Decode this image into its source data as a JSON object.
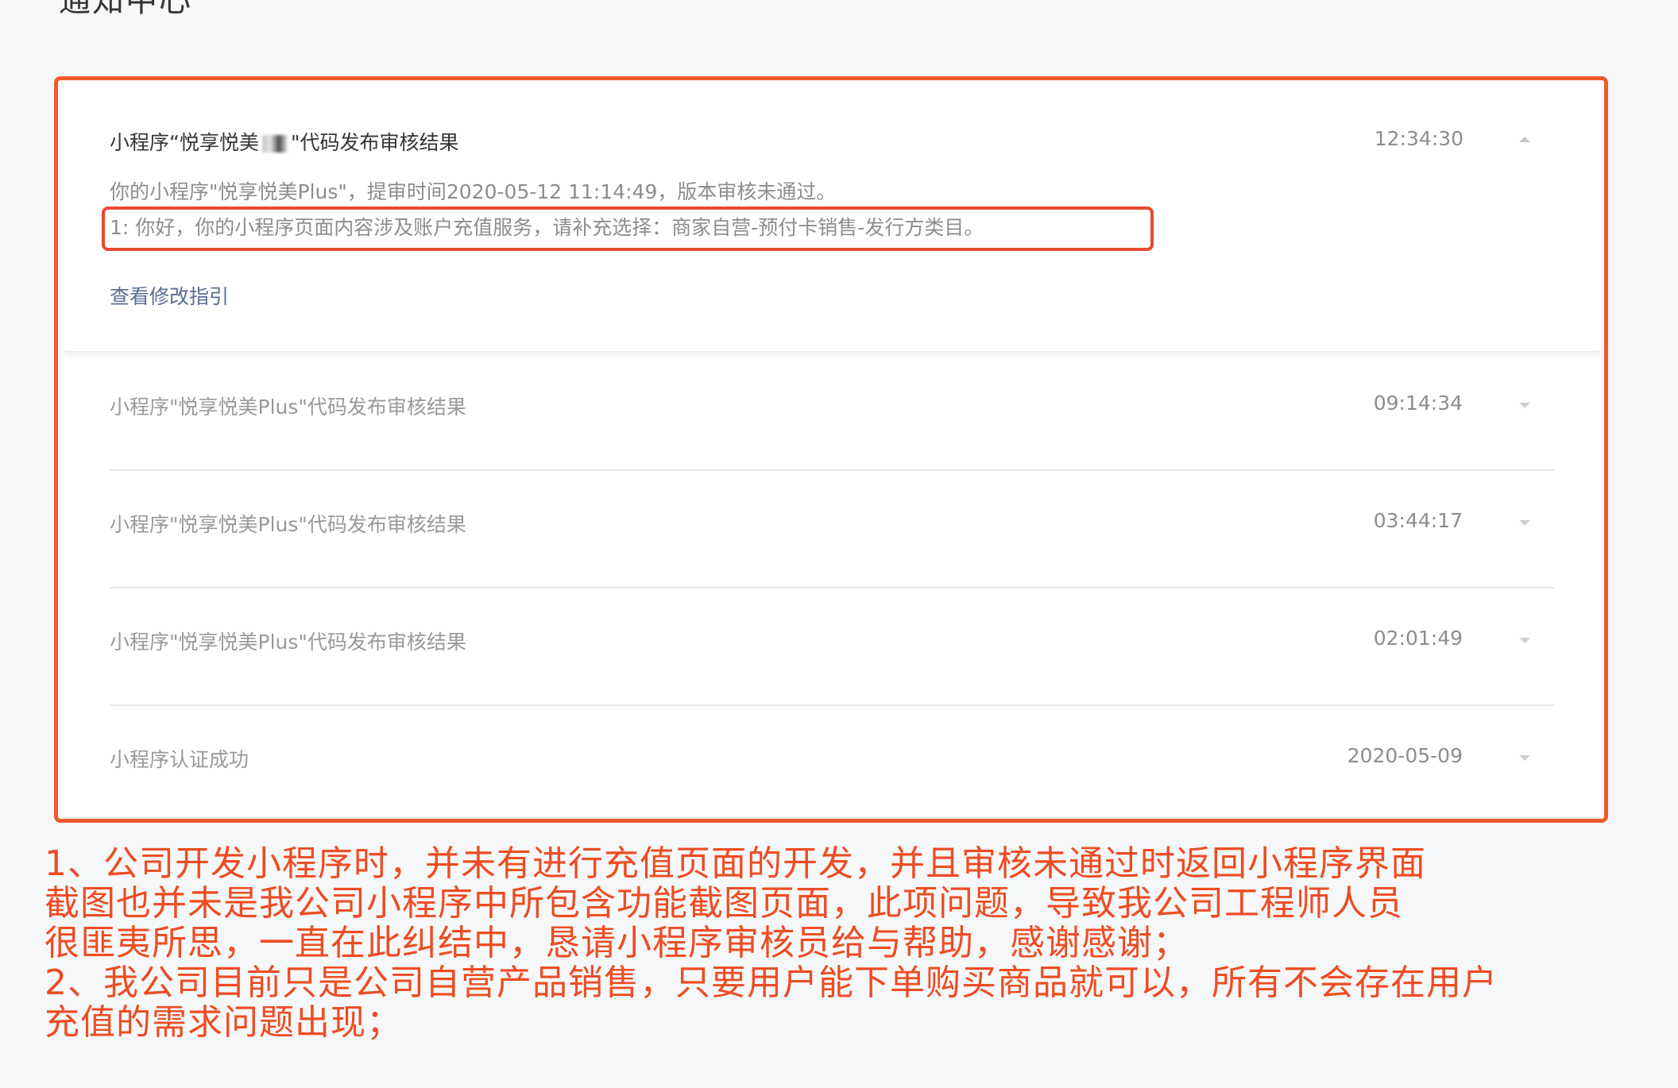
{
  "page": {
    "title": "通知中心"
  },
  "expanded_item": {
    "title_prefix": "小程序“悦享悦美",
    "title_suffix": "\"代码发布审核结果",
    "time": "12:34:30",
    "detail_line1": "你的小程序\"悦享悦美Plus\"，提审时间2020-05-12 11:14:49，版本审核未通过。",
    "detail_line2": "1: 你好，你的小程序页面内容涉及账户充值服务，请补充选择：商家自营-预付卡销售-发行方类目。",
    "guide_link": "查看修改指引",
    "toggle_icon": "caret-up-icon"
  },
  "items": [
    {
      "title": "小程序\"悦享悦美Plus\"代码发布审核结果",
      "time": "09:14:34"
    },
    {
      "title": "小程序\"悦享悦美Plus\"代码发布审核结果",
      "time": "03:44:17"
    },
    {
      "title": "小程序\"悦享悦美Plus\"代码发布审核结果",
      "time": "02:01:49"
    },
    {
      "title": "小程序认证成功",
      "time": "2020-05-09"
    }
  ],
  "annotation": {
    "line1": "1、公司开发小程序时，并未有进行充值页面的开发，并且审核未通过时返回小程序界面",
    "line2": "截图也并未是我公司小程序中所包含功能截图页面，此项问题，导致我公司工程师人员",
    "line3": "很匪夷所思，一直在此纠结中，恳请小程序审核员给与帮助，感谢感谢；",
    "line4": "2、我公司目前只是公司自营产品销售，只要用户能下单购买商品就可以，所有不会存在用户",
    "line5": "充值的需求问题出现；"
  },
  "colors": {
    "annotation_red": "#ee4c22",
    "frame_red": "#ef5a2b",
    "link": "#586c94"
  }
}
